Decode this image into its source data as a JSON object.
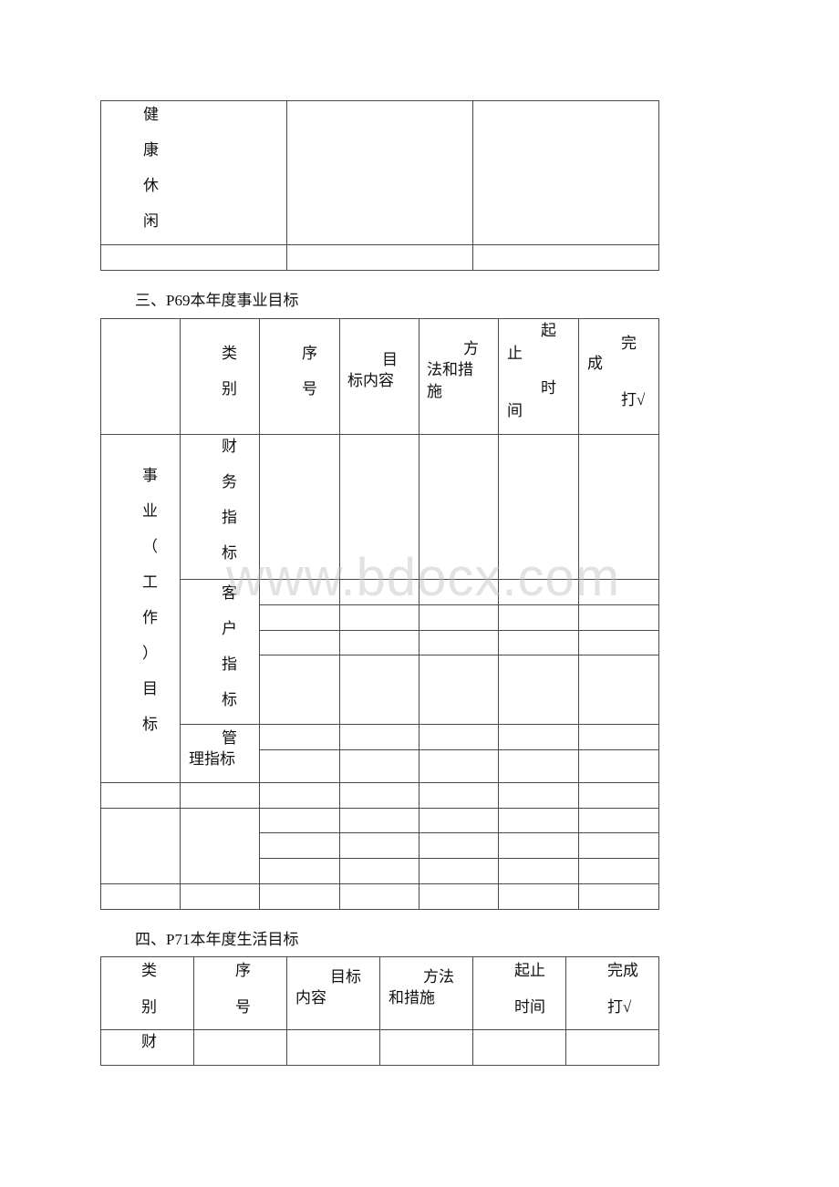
{
  "table1": {
    "category_chars": [
      "健",
      "康",
      "休",
      "闲"
    ]
  },
  "section3": {
    "heading": "三、P69本年度事业目标",
    "header": {
      "category": [
        "类",
        "别"
      ],
      "serial": [
        "序",
        "号"
      ],
      "goal_line1": "目",
      "goal_line2": "标内容",
      "method_line1": "方",
      "method_line2": "法和措",
      "method_line3": "施",
      "time_1": "起",
      "time_2": "止",
      "time_3": "时",
      "time_4": "间",
      "done_1": "完",
      "done_2": "成",
      "done_3": "打√"
    },
    "group_label": [
      "事",
      "业",
      "（",
      "工",
      "作",
      "）",
      "目",
      "标"
    ],
    "finance_label": [
      "财",
      "务",
      "指",
      "标"
    ],
    "customer_label": [
      "客",
      "户",
      "指",
      "标"
    ],
    "management_line1": "管",
    "management_line2": "理指标"
  },
  "section4": {
    "heading": "四、P71本年度生活目标",
    "header": {
      "category": [
        "类",
        "别"
      ],
      "serial": [
        "序",
        "号"
      ],
      "goal_line1": "目标",
      "goal_line2": "内容",
      "method_line1": "方法",
      "method_line2": "和措施",
      "time_line1": "起止",
      "time_line2": "时间",
      "done_line1": "完成",
      "done_line2": "打√"
    },
    "first_row_category": "财"
  },
  "watermark": "www.bdocx.com"
}
